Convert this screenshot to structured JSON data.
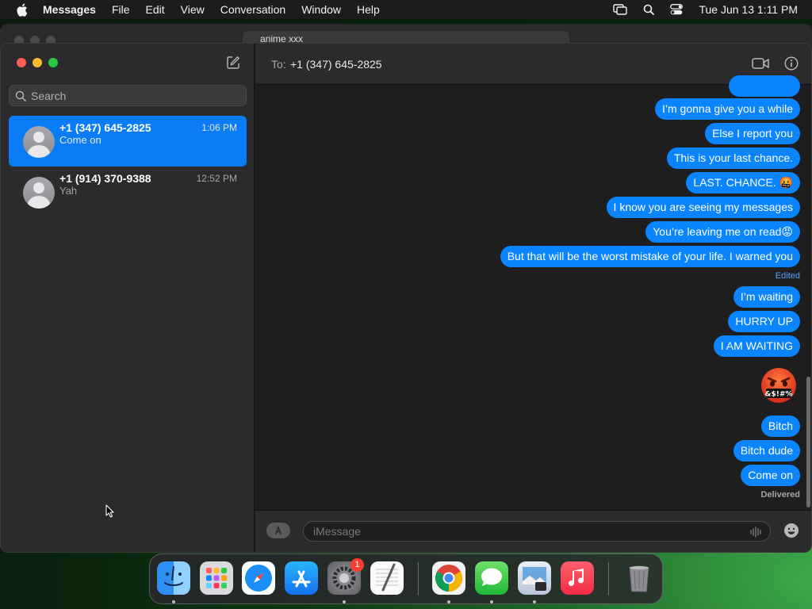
{
  "menubar": {
    "app_name": "Messages",
    "menus": [
      "File",
      "Edit",
      "View",
      "Conversation",
      "Window",
      "Help"
    ],
    "clock": "Tue Jun 13  1:11 PM"
  },
  "browser": {
    "url_text": "anime xxx"
  },
  "sidebar": {
    "search_placeholder": "Search",
    "conversations": [
      {
        "name": "+1 (347) 645-2825",
        "preview": "Come on",
        "time": "1:06 PM",
        "active": true
      },
      {
        "name": "+1 (914) 370-9388",
        "preview": "Yah",
        "time": "12:52 PM",
        "active": false
      }
    ]
  },
  "conversation": {
    "to_label": "To:",
    "to_value": "+1 (347) 645-2825",
    "messages": [
      "I’m gonna give you a while",
      "Else I report you",
      "This is your last chance.",
      "LAST. CHANCE. 🤬",
      "I know you are seeing my messages",
      "You’re leaving me on read😡",
      "But that will be the worst mistake of your life. I warned you",
      "I’m waiting",
      "HURRY UP",
      "I AM WAITING",
      "Bitch",
      "Bitch dude",
      "Come on"
    ],
    "edited_label": "Edited",
    "big_emoji_text": "&$!#%",
    "delivered_label": "Delivered",
    "input_placeholder": "iMessage"
  },
  "dock": {
    "apps": [
      "finder-icon",
      "launchpad-icon",
      "safari-icon",
      "app-store-icon",
      "system-settings-icon",
      "textedit-icon",
      "chrome-icon",
      "messages-icon",
      "preview-icon",
      "music-icon",
      "trash-icon"
    ],
    "settings_badge": "1"
  },
  "colors": {
    "bubble_blue": "#0a84ff",
    "selected_row": "#0a7cf5",
    "window_bg": "#1e1e1e",
    "sidebar_bg": "#2b2b2d"
  }
}
